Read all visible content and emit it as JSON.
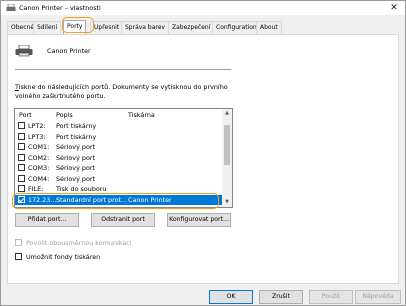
{
  "window": {
    "title": "Canon Printer – vlastnosti",
    "close_glyph": "✕"
  },
  "tabs": [
    {
      "label": "Obecné"
    },
    {
      "label": "Sdílení"
    },
    {
      "label": "Porty"
    },
    {
      "label": "Upřesnit"
    },
    {
      "label": "Správa barev"
    },
    {
      "label": "Zabezpečení"
    },
    {
      "label": "Configuration"
    },
    {
      "label": "About"
    }
  ],
  "active_tab": "Porty",
  "printer": {
    "name": "Canon Printer"
  },
  "description": {
    "accel": "T",
    "line1_rest": "iskne do následujících portů. Dokumenty se vytisknou do prvního",
    "line2": "volného zaškrtnutého portu."
  },
  "list": {
    "headers": {
      "port": "Port",
      "popis": "Popis",
      "tiskarna": "Tiskárna"
    },
    "rows": [
      {
        "port": "LPT2:",
        "popis": "Port tiskárny",
        "tiskarna": "",
        "checked": false
      },
      {
        "port": "LPT3:",
        "popis": "Port tiskárny",
        "tiskarna": "",
        "checked": false
      },
      {
        "port": "COM1:",
        "popis": "Sériový port",
        "tiskarna": "",
        "checked": false
      },
      {
        "port": "COM2:",
        "popis": "Sériový port",
        "tiskarna": "",
        "checked": false
      },
      {
        "port": "COM3:",
        "popis": "Sériový port",
        "tiskarna": "",
        "checked": false
      },
      {
        "port": "COM4:",
        "popis": "Sériový port",
        "tiskarna": "",
        "checked": false
      },
      {
        "port": "FILE:",
        "popis": "Tisk do souboru",
        "tiskarna": "",
        "checked": false
      },
      {
        "port": "172.23...",
        "popis": "Standardní port prot...",
        "tiskarna": "Canon Printer",
        "checked": true
      }
    ]
  },
  "buttons": {
    "add_port": "Přidat port...",
    "delete_port": "Odstranit port",
    "configure_port": "Konfigurovat port..."
  },
  "options": {
    "bidirectional": {
      "label": "Povolit obousměrnou komunikaci",
      "checked": false,
      "enabled": false
    },
    "pooling": {
      "label": "Umožnit fondy tiskáren",
      "checked": false,
      "enabled": true
    }
  },
  "footer": {
    "ok": "OK",
    "cancel": "Zrušit",
    "apply": "Použít",
    "help": "Nápověda"
  },
  "colors": {
    "selection": "#0078d7",
    "highlight": "#f0a020"
  }
}
